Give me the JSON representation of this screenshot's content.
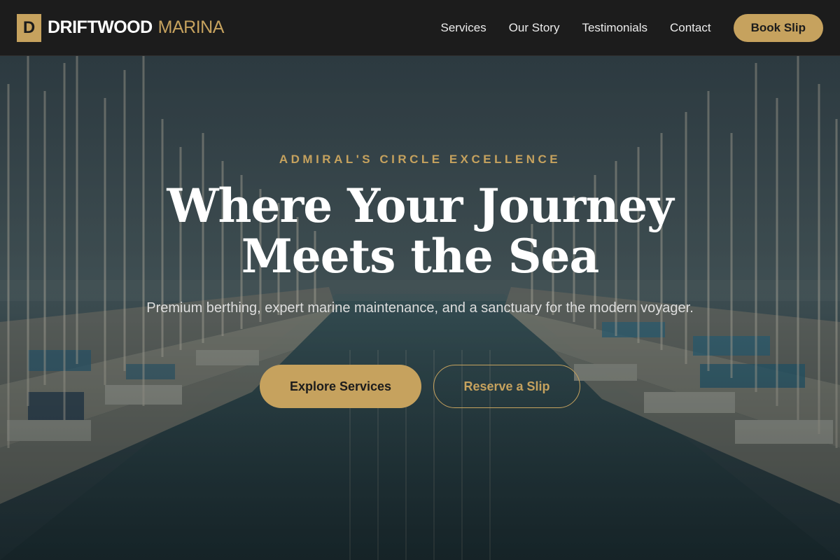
{
  "brand": {
    "mark": "D",
    "name_strong": "DRIFTWOOD",
    "name_light": "MARINA",
    "accent_color": "#c6a25e"
  },
  "nav": {
    "items": [
      {
        "label": "Services"
      },
      {
        "label": "Our Story"
      },
      {
        "label": "Testimonials"
      },
      {
        "label": "Contact"
      }
    ],
    "cta_label": "Book Slip"
  },
  "hero": {
    "eyebrow": "ADMIRAL'S CIRCLE EXCELLENCE",
    "headline_line1": "Where Your Journey",
    "headline_line2": "Meets the Sea",
    "subhead": "Premium berthing, expert marine maintenance, and a sanctuary for the modern voyager.",
    "primary_cta": "Explore Services",
    "secondary_cta": "Reserve a Slip",
    "background": "marina-photo"
  }
}
